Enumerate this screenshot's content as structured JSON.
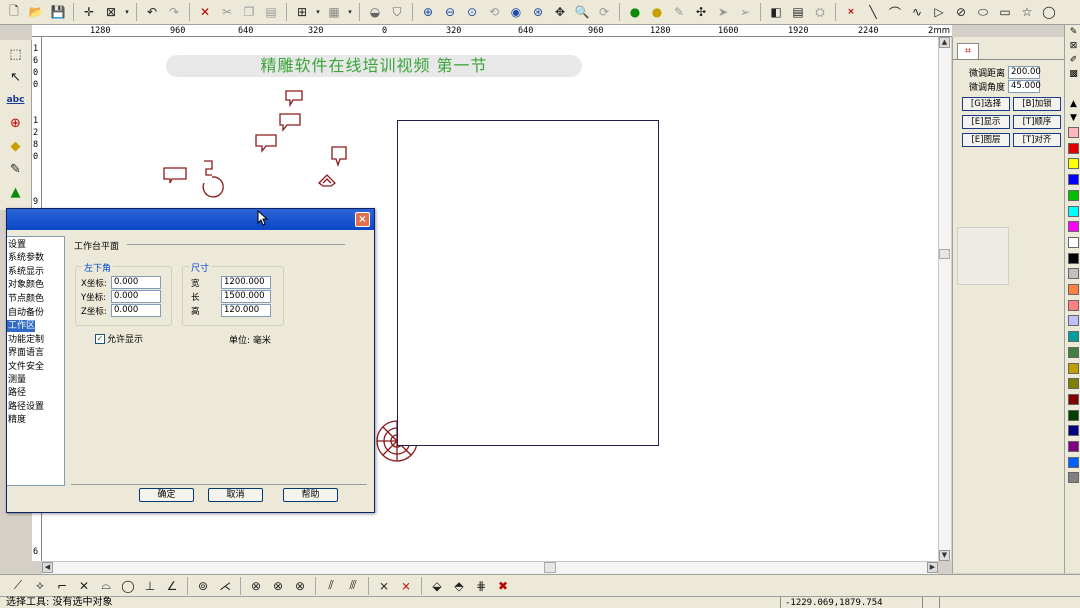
{
  "toolbar": {
    "icons": [
      "new-icon",
      "open-icon",
      "save-icon",
      "crosshair-icon",
      "select-box-icon",
      "undo-icon",
      "redo-icon",
      "delete-icon",
      "cut-icon",
      "copy-icon",
      "paste-icon",
      "grid-icon",
      "layer-icon",
      "shield-icon",
      "zoom-in-icon",
      "zoom-out-icon",
      "zoom-fit-icon",
      "refresh-icon",
      "pan-icon",
      "zoom-icon",
      "rotate-icon",
      "bulb-icon",
      "draw-icon",
      "node-icon",
      "mirror-icon",
      "table-icon",
      "pencil-icon",
      "line-icon",
      "arc-icon",
      "curve-icon",
      "triangle-icon",
      "circle-icon",
      "ellipse-icon",
      "rect-icon",
      "star-icon"
    ]
  },
  "rulers": {
    "h_ticks": [
      "1280",
      "960",
      "640",
      "320",
      "0",
      "320",
      "640",
      "960",
      "1280",
      "1600",
      "1920",
      "2240"
    ],
    "unit": "2mm",
    "v_digits": [
      "1",
      "6",
      "0",
      "0",
      "1",
      "2",
      "8",
      "0",
      "9",
      "6"
    ]
  },
  "canvas": {
    "banner": "精雕软件在线培训视频  第一节"
  },
  "right_panel": {
    "fine_distance_label": "微调距离",
    "fine_distance_value": "200.00",
    "fine_angle_label": "微调角度",
    "fine_angle_value": "45.000",
    "buttons": [
      "[G]选择",
      "[B]加锁",
      "[E]显示",
      "[T]顺序",
      "[E]图层",
      "[T]对齐"
    ]
  },
  "palette": {
    "colors": [
      "#ffb6c1",
      "#e00000",
      "#ffff00",
      "#0000ff",
      "#00c000",
      "#00ffff",
      "#ff00ff",
      "#ffffff",
      "#000000",
      "#c0c0c0",
      "#ff8040",
      "#ff8080",
      "#c0c0ff",
      "#00a0a0",
      "#408040",
      "#c0a000",
      "#808000",
      "#800000",
      "#004000",
      "#000080",
      "#800080",
      "#0060ff",
      "#808080"
    ]
  },
  "dialog": {
    "close": "×",
    "list_items": [
      "设置",
      "系统参数",
      "系统显示",
      "对象颜色",
      "节点颜色",
      "自动备份",
      "工作区",
      "功能定制",
      "界面语言",
      "文件安全",
      "测量",
      "路径",
      "路径设置",
      "精度"
    ],
    "selected_item": "工作区",
    "section_title": "工作台平面",
    "corner_group_title": "左下角",
    "x_label": "X坐标:",
    "x_value": "0.000",
    "y_label": "Y坐标:",
    "y_value": "0.000",
    "z_label": "Z坐标:",
    "z_value": "0.000",
    "size_group_title": "尺寸",
    "width_label": "宽",
    "width_value": "1200.000",
    "length_label": "长",
    "length_value": "1500.000",
    "height_label": "高",
    "height_value": "120.000",
    "allow_display": "允许显示",
    "unit_label": "单位:",
    "unit_value": "毫米",
    "ok": "确定",
    "cancel": "取消",
    "help": "帮助"
  },
  "status": {
    "text": "选择工具: 没有选中对象",
    "coords": "-1229.069,1879.754"
  }
}
